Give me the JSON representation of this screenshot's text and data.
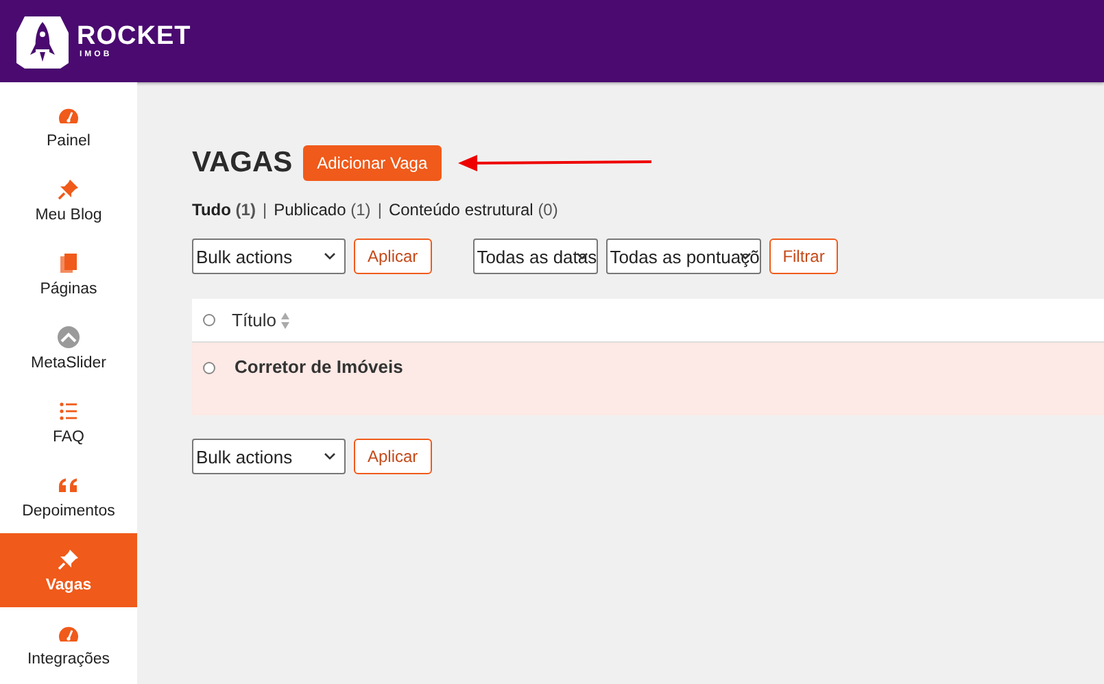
{
  "brand": {
    "name": "ROCKET",
    "sub": "IMOB"
  },
  "sidebar": {
    "items": [
      {
        "label": "Painel",
        "kind": "gauge",
        "selected": false
      },
      {
        "label": "Meu Blog",
        "kind": "pin",
        "selected": false
      },
      {
        "label": "Páginas",
        "kind": "pages",
        "selected": false
      },
      {
        "label": "MetaSlider",
        "kind": "slider",
        "selected": false
      },
      {
        "label": "FAQ",
        "kind": "list",
        "selected": false
      },
      {
        "label": "Depoimentos",
        "kind": "quote",
        "selected": false
      },
      {
        "label": "Vagas",
        "kind": "pin",
        "selected": true
      },
      {
        "label": "Integrações",
        "kind": "gauge",
        "selected": false
      }
    ]
  },
  "page": {
    "title": "VAGAS",
    "add_button": "Adicionar Vaga"
  },
  "filters": [
    {
      "kind": "link",
      "label": "Tudo",
      "count": "(1)",
      "selected": true
    },
    {
      "kind": "separator",
      "text": "|"
    },
    {
      "kind": "link",
      "label": "Publicado",
      "count": "(1)",
      "selected": false
    },
    {
      "kind": "separator",
      "text": "|"
    },
    {
      "kind": "link",
      "label": "Conteúdo estrutural",
      "count": "(0)",
      "selected": false
    }
  ],
  "top_actions": {
    "bulk": "Bulk actions",
    "apply": "Aplicar",
    "dates": "Todas as datas",
    "ratings": "Todas as pontuaçõ",
    "filter": "Filtrar"
  },
  "table": {
    "column": "Título",
    "all_checked": false,
    "rows": [
      {
        "title": "Corretor de Imóveis",
        "checked": false
      }
    ]
  },
  "bottom_actions": {
    "bulk": "Bulk actions",
    "apply": "Aplicar"
  }
}
